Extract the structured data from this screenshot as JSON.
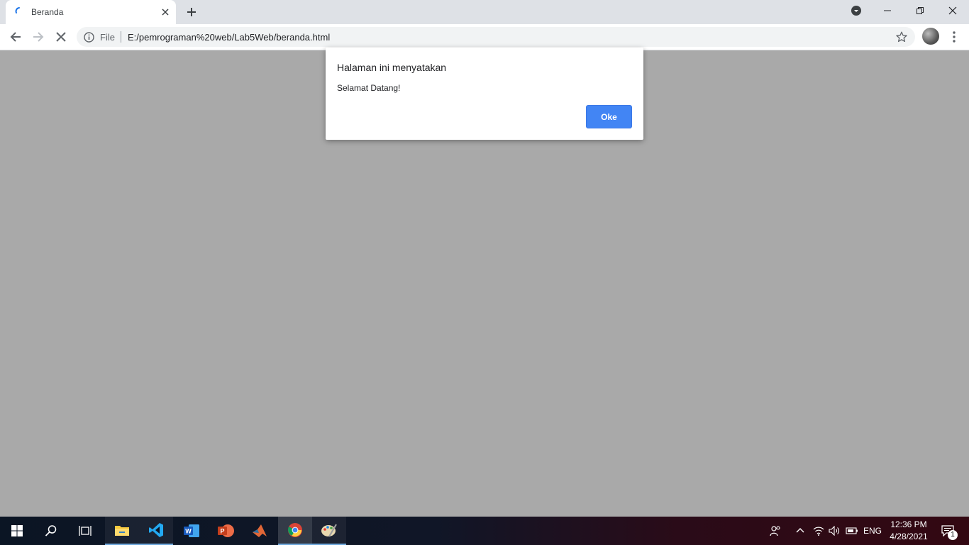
{
  "browser": {
    "tab": {
      "title": "Beranda"
    },
    "omnibox": {
      "security_label": "File",
      "url": "E:/pemrograman%20web/Lab5Web/beranda.html"
    }
  },
  "dialog": {
    "title": "Halaman ini menyatakan",
    "message": "Selamat Datang!",
    "ok_label": "Oke"
  },
  "taskbar": {
    "apps": [
      "start-icon",
      "search-icon",
      "task-view-icon",
      "file-explorer-icon",
      "vscode-icon",
      "word-icon",
      "powerpoint-icon",
      "matlab-icon",
      "chrome-icon",
      "paint-icon"
    ],
    "tray": {
      "language": "ENG",
      "time": "12:36 PM",
      "date": "4/28/2021",
      "notification_count": "1"
    }
  },
  "colors": {
    "accent": "#4285f4",
    "page_background": "#a9a9a9",
    "tab_strip": "#dee1e6"
  }
}
